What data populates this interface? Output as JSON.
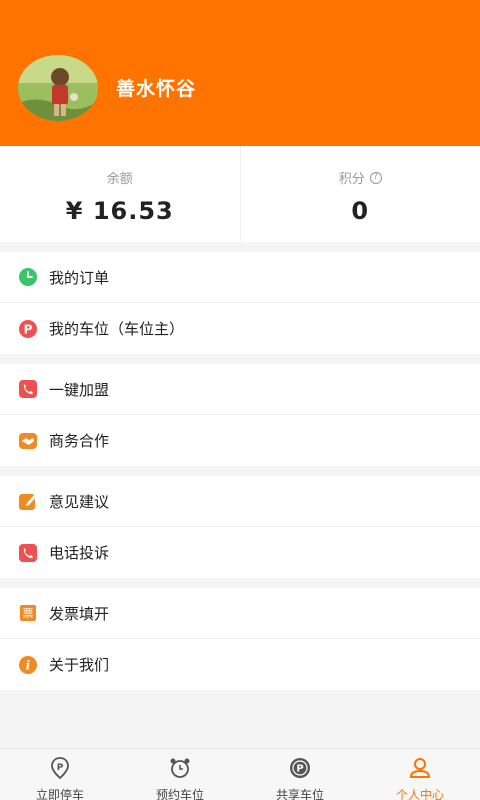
{
  "user": {
    "name": "善水怀谷"
  },
  "stats": {
    "balance_label": "余额",
    "balance_value": "¥ 16.53",
    "points_label": "积分",
    "points_help": "?",
    "points_value": "0"
  },
  "menu": {
    "group1": [
      {
        "label": "我的订单",
        "icon": "clock-icon",
        "color": "#3cc46a"
      },
      {
        "label": "我的车位（车位主）",
        "icon": "parking-p-icon",
        "color": "#ef5151"
      }
    ],
    "group2": [
      {
        "label": "一键加盟",
        "icon": "phone-icon",
        "color": "#ef5151"
      },
      {
        "label": "商务合作",
        "icon": "handshake-icon",
        "color": "#f08a24"
      }
    ],
    "group3": [
      {
        "label": "意见建议",
        "icon": "edit-icon",
        "color": "#f08a24"
      },
      {
        "label": "电话投诉",
        "icon": "phone-icon",
        "color": "#ef5151"
      }
    ],
    "group4": [
      {
        "label": "发票填开",
        "icon": "invoice-icon",
        "icon_text": "票",
        "color": "#f08a24"
      },
      {
        "label": "关于我们",
        "icon": "info-icon",
        "icon_text": "i",
        "color": "#f08a24"
      }
    ]
  },
  "tabs": [
    {
      "label": "立即停车",
      "icon": "parking-pin-icon"
    },
    {
      "label": "预约车位",
      "icon": "alarm-clock-icon"
    },
    {
      "label": "共享车位",
      "icon": "parking-circle-icon"
    },
    {
      "label": "个人中心",
      "icon": "user-icon",
      "active": true
    }
  ],
  "colors": {
    "brand": "#ff7300",
    "background": "#f4f4f4"
  }
}
